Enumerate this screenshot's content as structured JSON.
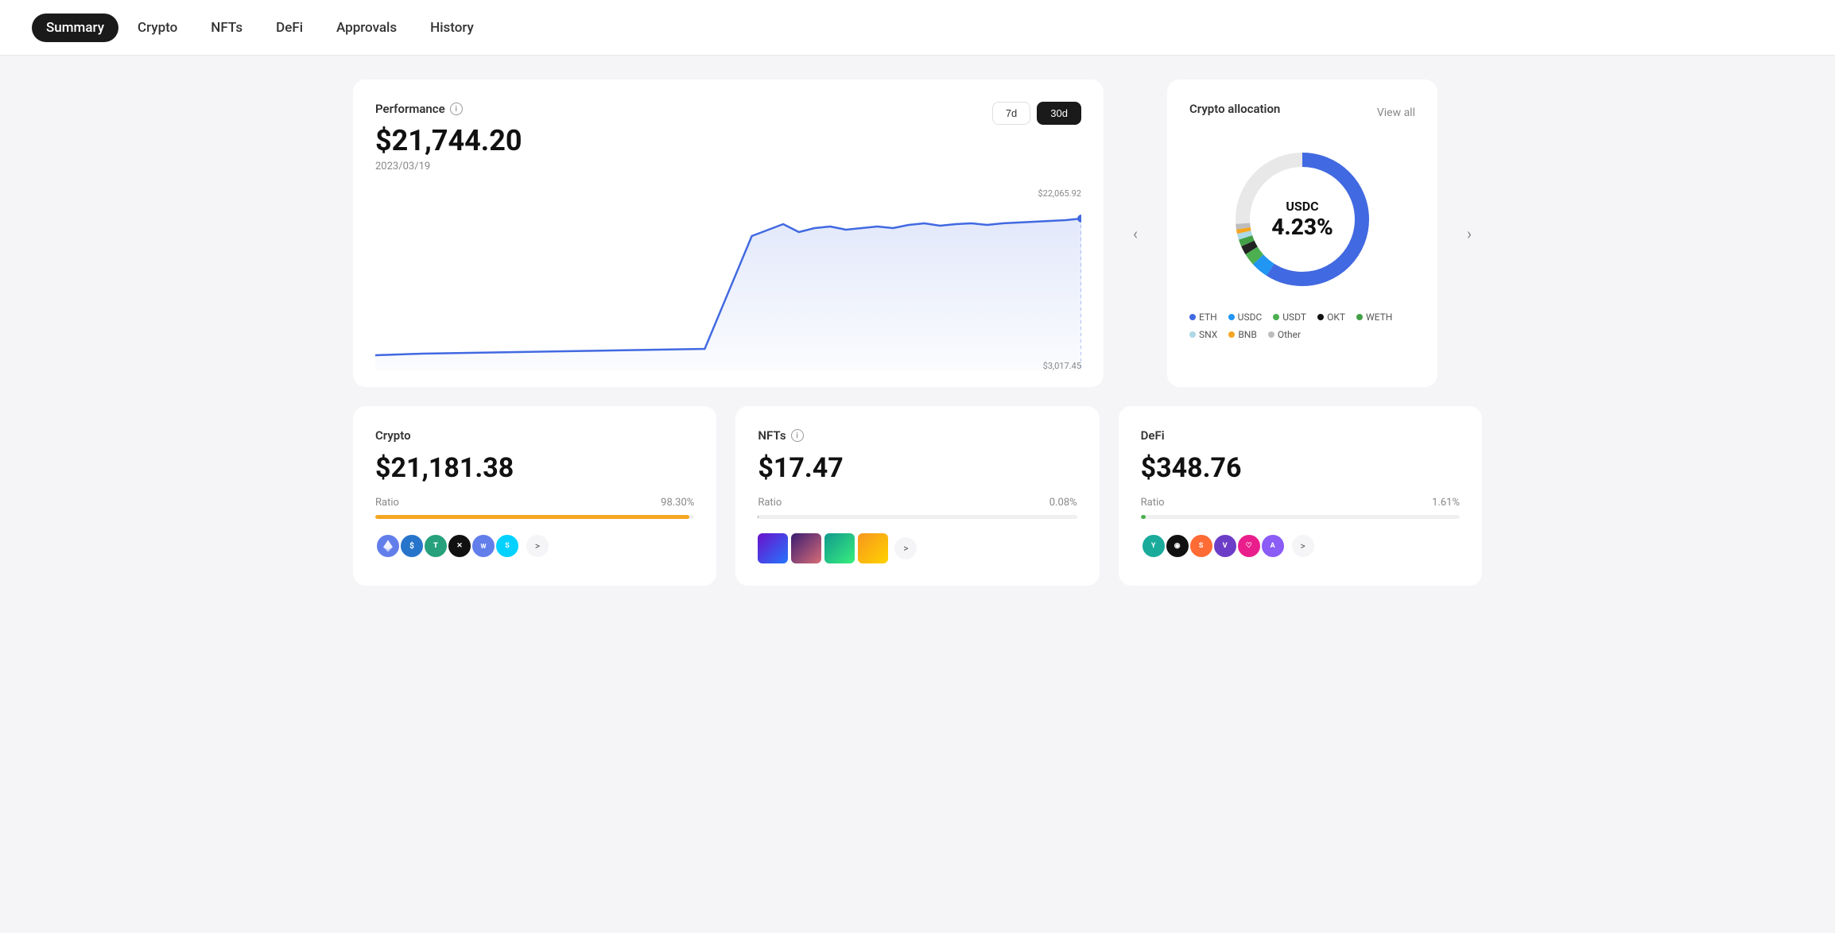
{
  "nav": {
    "items": [
      {
        "label": "Summary",
        "active": true
      },
      {
        "label": "Crypto",
        "active": false
      },
      {
        "label": "NFTs",
        "active": false
      },
      {
        "label": "DeFi",
        "active": false
      },
      {
        "label": "Approvals",
        "active": false
      },
      {
        "label": "History",
        "active": false
      }
    ]
  },
  "performance": {
    "title": "Performance",
    "value": "$21,744.20",
    "date": "2023/03/19",
    "timeBtns": [
      "7d",
      "30d"
    ],
    "activeBtn": "30d",
    "highLabel": "$22,065.92",
    "lowLabel": "$3,017.45"
  },
  "allocation": {
    "title": "Crypto allocation",
    "viewAllLabel": "View all",
    "center": {
      "label": "USDC",
      "percent": "4.23%"
    },
    "legend": [
      {
        "label": "ETH",
        "color": "#4169e1"
      },
      {
        "label": "USDC",
        "color": "#2196f3"
      },
      {
        "label": "USDT",
        "color": "#4caf50"
      },
      {
        "label": "OKT",
        "color": "#111111"
      },
      {
        "label": "WETH",
        "color": "#43a047"
      },
      {
        "label": "SNX",
        "color": "#add8e6"
      },
      {
        "label": "BNB",
        "color": "#f5a623"
      },
      {
        "label": "Other",
        "color": "#bdbdbd"
      }
    ]
  },
  "crypto": {
    "title": "Crypto",
    "value": "$21,181.38",
    "ratioLabel": "Ratio",
    "ratioPct": "98.30%",
    "progressPct": 98.3,
    "progressColor": "#f5a623"
  },
  "nfts": {
    "title": "NFTs",
    "value": "$17.47",
    "ratioLabel": "Ratio",
    "ratioPct": "0.08%",
    "progressPct": 0.08,
    "progressColor": "#bbb"
  },
  "defi": {
    "title": "DeFi",
    "value": "$348.76",
    "ratioLabel": "Ratio",
    "ratioPct": "1.61%",
    "progressPct": 1.61,
    "progressColor": "#4caf50"
  }
}
